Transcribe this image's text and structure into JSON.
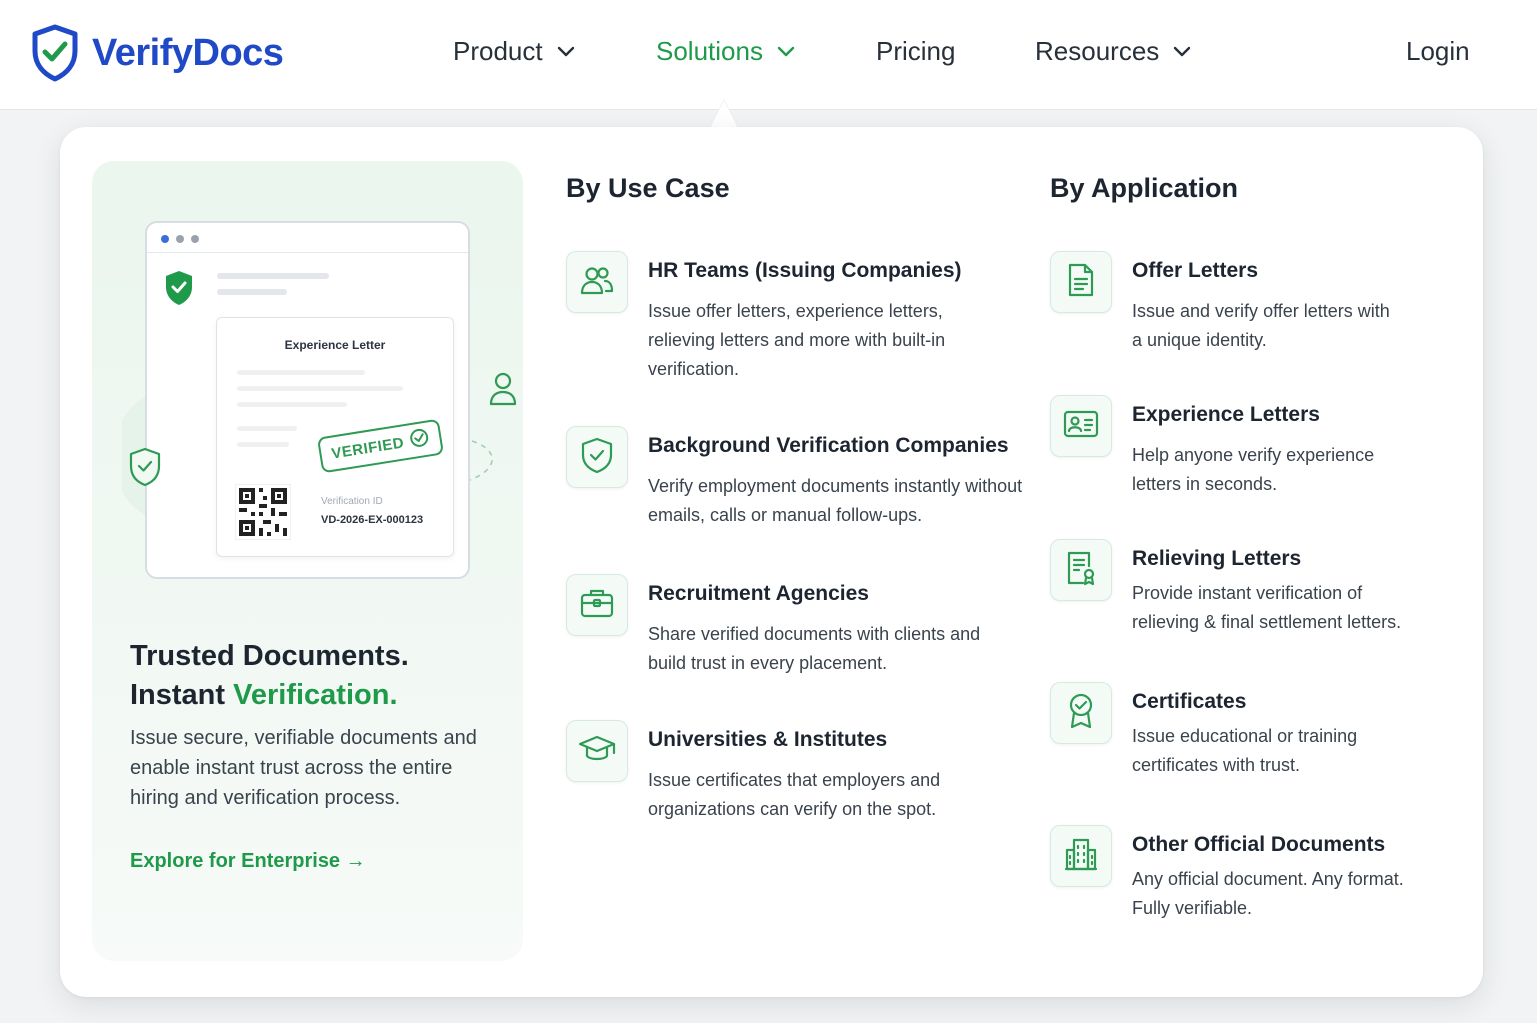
{
  "brand": {
    "name": "VerifyDocs"
  },
  "colors": {
    "brand_blue": "#1f49c6",
    "accent_green": "#1f9a4a",
    "text_dark": "#1c2530"
  },
  "nav": {
    "product": "Product",
    "solutions": "Solutions",
    "pricing": "Pricing",
    "resources": "Resources",
    "login": "Login",
    "active": "Solutions"
  },
  "promo": {
    "mock_doc_title": "Experience Letter",
    "stamp": "VERIFIED",
    "verification_label": "Verification ID",
    "verification_id": "VD-2026-EX-000123",
    "heading_line1": "Trusted Documents.",
    "heading_line2_plain": "Instant ",
    "heading_line2_accent": "Verification.",
    "description": "Issue secure, verifiable documents and enable instant trust across the entire hiring and verification process.",
    "link": "Explore for Enterprise →"
  },
  "use_case": {
    "heading": "By Use Case",
    "items": [
      {
        "title": "HR Teams (Issuing Companies)",
        "desc": "Issue offer letters, experience letters, relieving letters and more with built-in verification.",
        "icon": "users-icon"
      },
      {
        "title": "Background Verification Companies",
        "desc": "Verify employment documents instantly without emails, calls or manual follow-ups.",
        "icon": "shield-check-icon"
      },
      {
        "title": "Recruitment Agencies",
        "desc": "Share verified documents with clients and build trust in every placement.",
        "icon": "briefcase-icon"
      },
      {
        "title": "Universities & Institutes",
        "desc": "Issue certificates that employers and organizations can verify on the spot.",
        "icon": "graduation-cap-icon"
      }
    ]
  },
  "application": {
    "heading": "By Application",
    "items": [
      {
        "title": "Offer Letters",
        "desc": "Issue and verify offer letters with a unique identity.",
        "icon": "document-icon"
      },
      {
        "title": "Experience Letters",
        "desc": "Help anyone verify experience letters in seconds.",
        "icon": "id-card-icon"
      },
      {
        "title": "Relieving Letters",
        "desc": "Provide instant verification of relieving & final settlement letters.",
        "icon": "document-signed-icon"
      },
      {
        "title": "Certificates",
        "desc": "Issue educational or training certificates with trust.",
        "icon": "award-icon"
      },
      {
        "title": "Other Official Documents",
        "desc": "Any official document. Any format. Fully verifiable.",
        "icon": "building-icon"
      }
    ]
  }
}
